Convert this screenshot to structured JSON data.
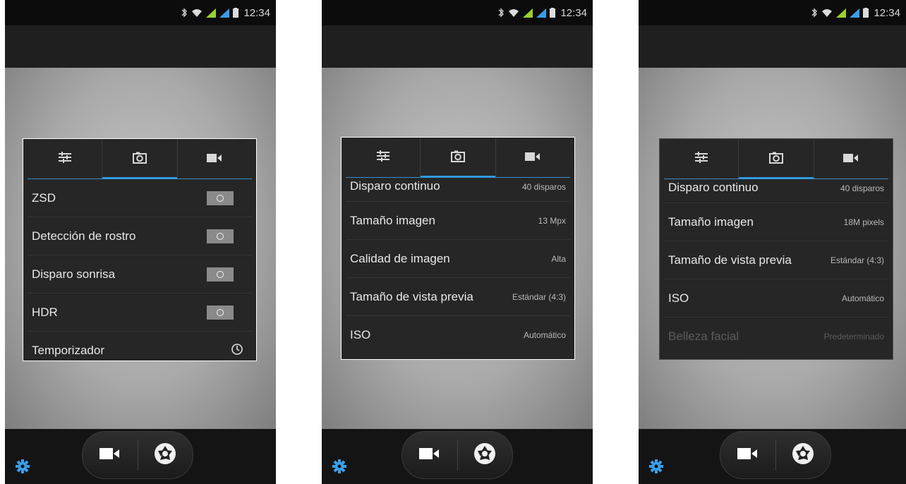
{
  "status_bar": {
    "time": "12:34"
  },
  "screens": [
    {
      "rows": [
        {
          "label": "ZSD",
          "control": "toggle",
          "state": "off"
        },
        {
          "label": "Detección de rostro",
          "control": "toggle",
          "state": "off"
        },
        {
          "label": "Disparo sonrisa",
          "control": "toggle",
          "state": "off"
        },
        {
          "label": "HDR",
          "control": "toggle",
          "state": "off"
        },
        {
          "label": "Temporizador",
          "control": "timer-icon"
        }
      ]
    },
    {
      "rows": [
        {
          "label": "Disparo continuo",
          "value": "40 disparos"
        },
        {
          "label": "Tamaño imagen",
          "value": "13 Mpx"
        },
        {
          "label": "Calidad de imagen",
          "value": "Alta"
        },
        {
          "label": "Tamaño de vista previa",
          "value": "Estándar (4:3)"
        },
        {
          "label": "ISO",
          "value": "Automático"
        }
      ]
    },
    {
      "rows": [
        {
          "label": "Disparo continuo",
          "value": "40 disparos"
        },
        {
          "label": "Tamaño imagen",
          "value": "18M pixels"
        },
        {
          "label": "Tamaño de vista previa",
          "value": "Estándar (4:3)"
        },
        {
          "label": "ISO",
          "value": "Automático"
        },
        {
          "label": "Belleza facial",
          "value": "Predeterminado",
          "disabled": true
        }
      ]
    }
  ],
  "tabs": [
    "sliders-icon",
    "camera-icon",
    "video-icon"
  ],
  "active_tab": 1,
  "colors": {
    "accent": "#2f9be0"
  }
}
